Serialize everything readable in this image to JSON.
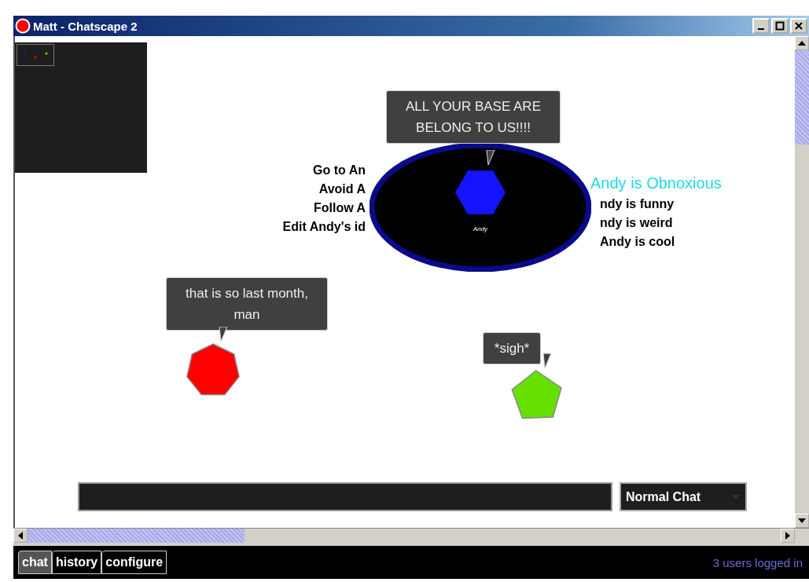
{
  "window": {
    "title": "Matt - Chatscape 2"
  },
  "users": [
    {
      "name": "Andy",
      "kind": "hexagon",
      "color": "#1414ff",
      "bubble": "ALL YOUR BASE ARE BELONG TO US!!!!",
      "focused": true
    },
    {
      "kind": "heptagon",
      "color": "#ff0000",
      "bubble": "that is so last month, man",
      "focused": false
    },
    {
      "kind": "pentagon",
      "color": "#66e000",
      "bubble": "*sigh*",
      "focused": false
    }
  ],
  "user_menu": {
    "actions": [
      "Go to An",
      "Avoid A",
      "Follow A",
      "Edit Andy's id"
    ],
    "comments": [
      {
        "text": "Andy is Obnoxious",
        "selected": true
      },
      {
        "text": "ndy is funny",
        "selected": false
      },
      {
        "text": "ndy is weird",
        "selected": false
      },
      {
        "text": "Andy is cool",
        "selected": false
      }
    ]
  },
  "chat_mode": {
    "value": "Normal Chat"
  },
  "tabs": [
    {
      "label": "chat",
      "selected": true
    },
    {
      "label": "history",
      "selected": false
    },
    {
      "label": "configure",
      "selected": false
    }
  ],
  "status": "3 users logged in"
}
